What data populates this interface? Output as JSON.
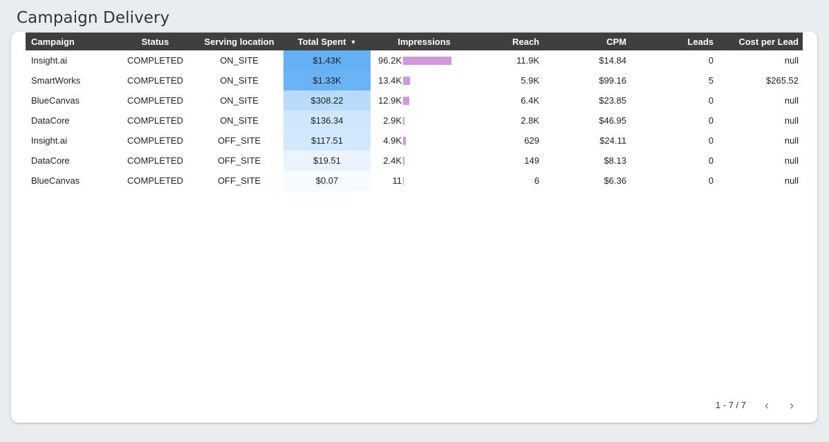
{
  "page": {
    "title": "Campaign Delivery"
  },
  "table": {
    "columns": [
      {
        "key": "campaign",
        "label": "Campaign",
        "align": "l"
      },
      {
        "key": "status",
        "label": "Status",
        "align": "c"
      },
      {
        "key": "location",
        "label": "Serving location",
        "align": "c"
      },
      {
        "key": "spent",
        "label": "Total Spent",
        "align": "c",
        "sorted": "desc"
      },
      {
        "key": "impressions",
        "label": "Impressions",
        "align": "c"
      },
      {
        "key": "reach",
        "label": "Reach",
        "align": "r"
      },
      {
        "key": "cpm",
        "label": "CPM",
        "align": "r"
      },
      {
        "key": "leads",
        "label": "Leads",
        "align": "r"
      },
      {
        "key": "cpl",
        "label": "Cost per Lead",
        "align": "r"
      }
    ],
    "rows": [
      {
        "campaign": "Insight.ai",
        "status": "COMPLETED",
        "location": "ON_SITE",
        "spent": "$1.43K",
        "spent_value": 1430,
        "impressions": "96.2K",
        "impressions_value": 96200,
        "reach": "11.9K",
        "cpm": "$14.84",
        "leads": "0",
        "cpl": "null"
      },
      {
        "campaign": "SmartWorks",
        "status": "COMPLETED",
        "location": "ON_SITE",
        "spent": "$1.33K",
        "spent_value": 1330,
        "impressions": "13.4K",
        "impressions_value": 13400,
        "reach": "5.9K",
        "cpm": "$99.16",
        "leads": "5",
        "cpl": "$265.52"
      },
      {
        "campaign": "BlueCanvas",
        "status": "COMPLETED",
        "location": "ON_SITE",
        "spent": "$308.22",
        "spent_value": 308.22,
        "impressions": "12.9K",
        "impressions_value": 12900,
        "reach": "6.4K",
        "cpm": "$23.85",
        "leads": "0",
        "cpl": "null"
      },
      {
        "campaign": "DataCore",
        "status": "COMPLETED",
        "location": "ON_SITE",
        "spent": "$136.34",
        "spent_value": 136.34,
        "impressions": "2.9K",
        "impressions_value": 2900,
        "reach": "2.8K",
        "cpm": "$46.95",
        "leads": "0",
        "cpl": "null"
      },
      {
        "campaign": "Insight.ai",
        "status": "COMPLETED",
        "location": "OFF_SITE",
        "spent": "$117.51",
        "spent_value": 117.51,
        "impressions": "4.9K",
        "impressions_value": 4900,
        "reach": "629",
        "cpm": "$24.11",
        "leads": "0",
        "cpl": "null"
      },
      {
        "campaign": "DataCore",
        "status": "COMPLETED",
        "location": "OFF_SITE",
        "spent": "$19.51",
        "spent_value": 19.51,
        "impressions": "2.4K",
        "impressions_value": 2400,
        "reach": "149",
        "cpm": "$8.13",
        "leads": "0",
        "cpl": "null"
      },
      {
        "campaign": "BlueCanvas",
        "status": "COMPLETED",
        "location": "OFF_SITE",
        "spent": "$0.07",
        "spent_value": 0.07,
        "impressions": "11",
        "impressions_value": 11,
        "reach": "6",
        "cpm": "$6.36",
        "leads": "0",
        "cpl": "null"
      }
    ]
  },
  "pagination": {
    "label": "1 - 7 / 7",
    "prev_icon": "chevron-left-icon",
    "next_icon": "chevron-right-icon"
  },
  "colors": {
    "header_bg": "#3f3f3f",
    "heat_max": "#64b0f4",
    "heat_min": "#f7fbff",
    "impressions_bar": "#d199dd"
  }
}
